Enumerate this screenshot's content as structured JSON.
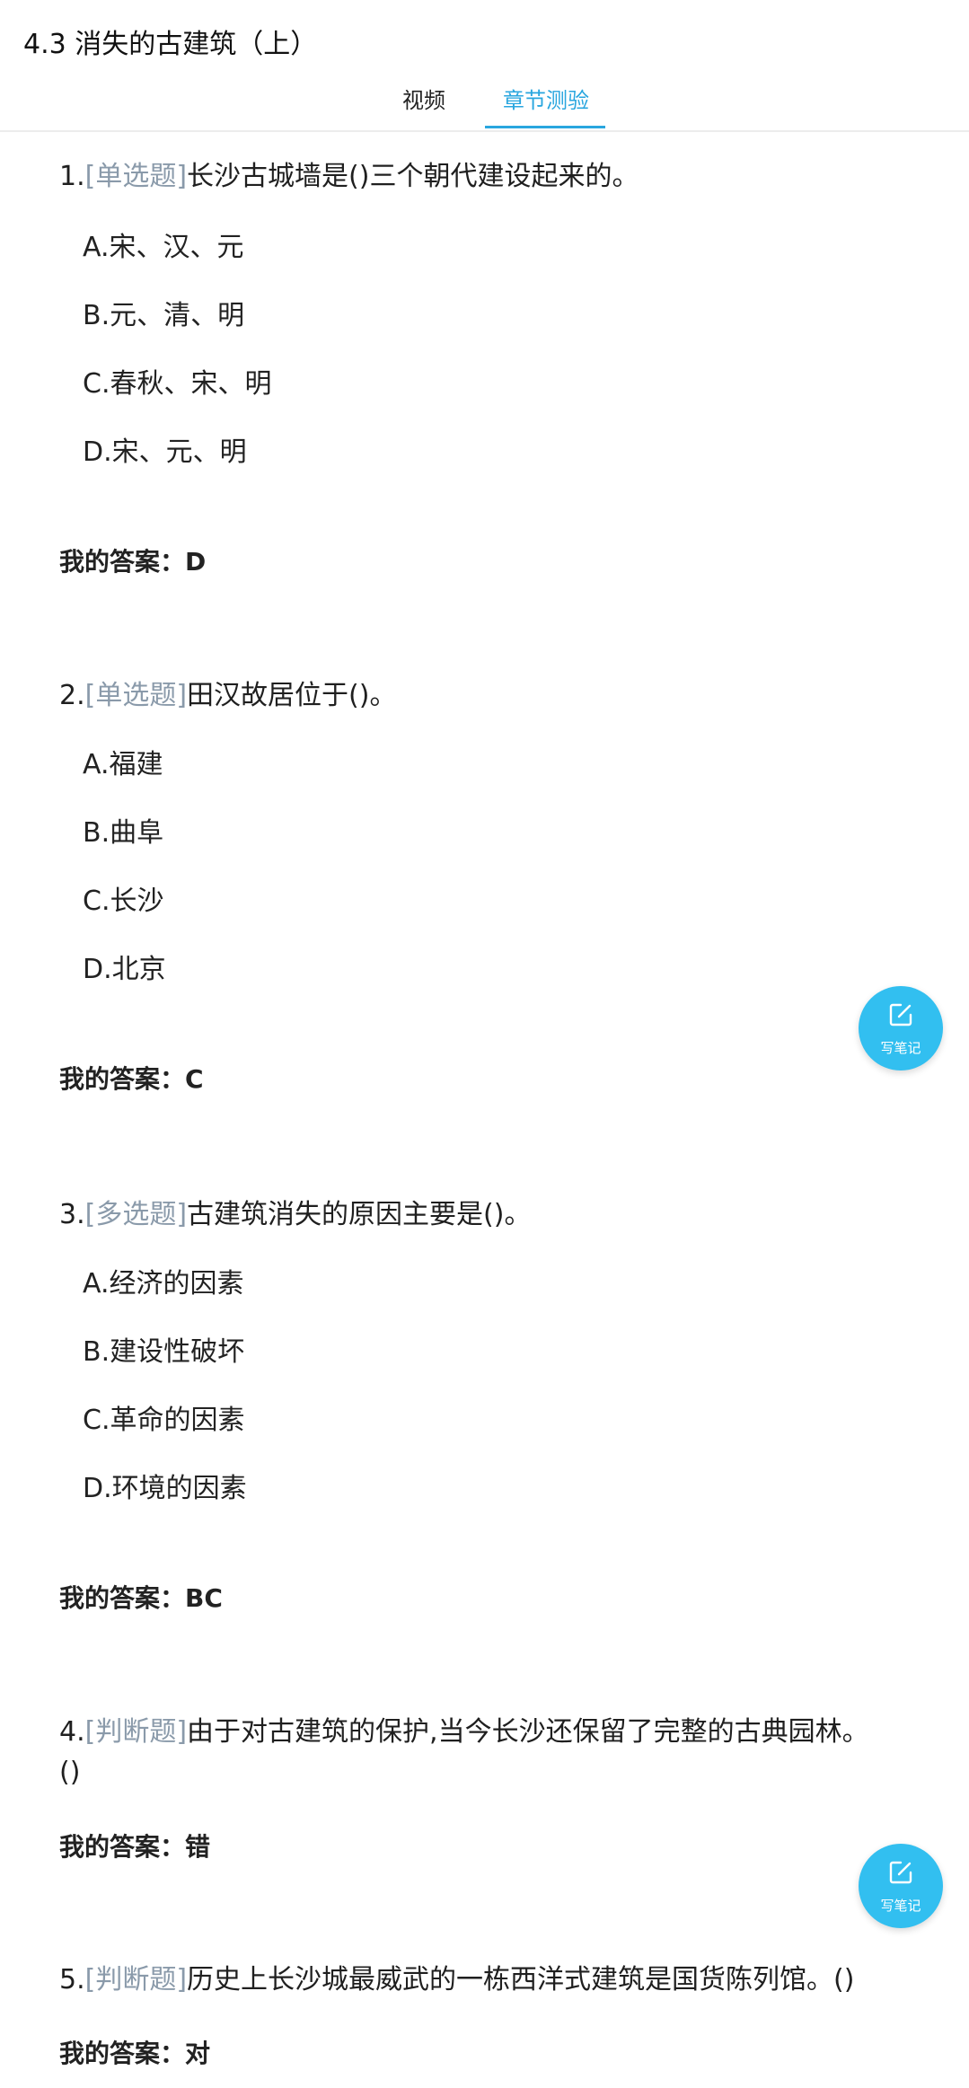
{
  "header": {
    "title": "4.3 消失的古建筑（上）",
    "tabs": [
      {
        "label": "视频",
        "active": false
      },
      {
        "label": "章节测验",
        "active": true
      }
    ]
  },
  "questions": [
    {
      "number": "1.",
      "tag": "[单选题]",
      "text": "长沙古城墙是()三个朝代建设起来的。",
      "options": [
        "A.宋、汉、元",
        "B.元、清、明",
        "C.春秋、宋、明",
        "D.宋、元、明"
      ],
      "answer": "我的答案：D"
    },
    {
      "number": "2.",
      "tag": "[单选题]",
      "text": "田汉故居位于()。",
      "options": [
        "A.福建",
        "B.曲阜",
        "C.长沙",
        "D.北京"
      ],
      "answer": "我的答案：C"
    },
    {
      "number": "3.",
      "tag": "[多选题]",
      "text": "古建筑消失的原因主要是()。",
      "options": [
        "A.经济的因素",
        "B.建设性破坏",
        "C.革命的因素",
        "D.环境的因素"
      ],
      "answer": "我的答案：BC"
    },
    {
      "number": "4.",
      "tag": "[判断题]",
      "text": "由于对古建筑的保护,当今长沙还保留了完整的古典园林。()",
      "options": [],
      "answer": "我的答案：错"
    },
    {
      "number": "5.",
      "tag": "[判断题]",
      "text": "历史上长沙城最威武的一栋西洋式建筑是国货陈列馆。()",
      "options": [],
      "answer": "我的答案：对"
    }
  ],
  "note_button": {
    "label": "写笔记",
    "icon": "edit-note-icon",
    "color": "#32bff0"
  },
  "colors": {
    "accent": "#29a6df",
    "tag": "#8a9aaa"
  }
}
